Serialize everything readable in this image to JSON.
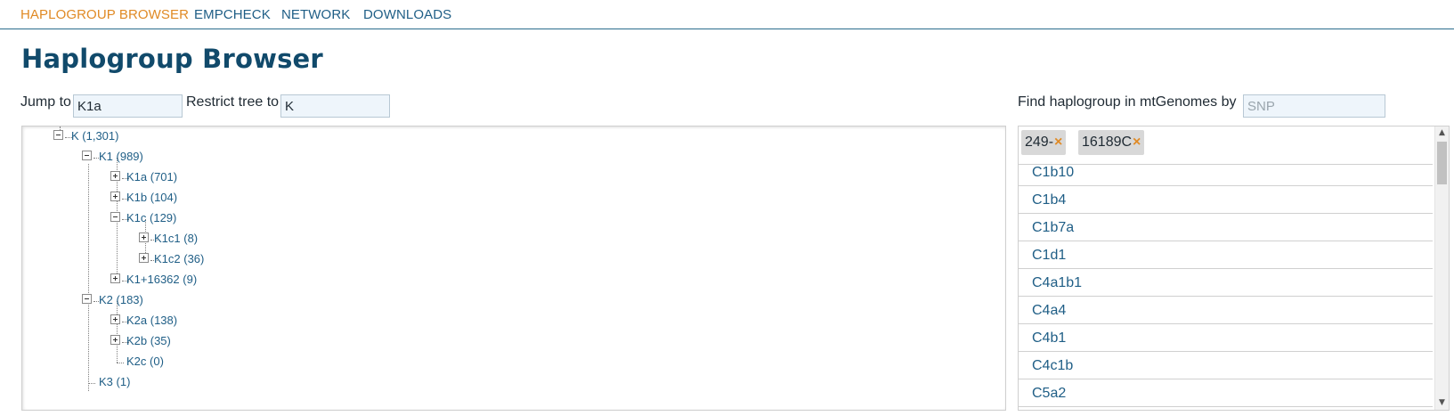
{
  "nav": {
    "items": [
      {
        "label": "HAPLOGROUP BROWSER",
        "active": true
      },
      {
        "label": "EMPCHECK",
        "active": false
      },
      {
        "label": "NETWORK",
        "active": false
      },
      {
        "label": "DOWNLOADS",
        "active": false
      }
    ]
  },
  "page_title": "Haplogroup Browser",
  "controls": {
    "jump_label": "Jump to",
    "jump_value": "K1a",
    "restrict_label": "Restrict tree to",
    "restrict_value": "K",
    "find_label": "Find haplogroup in mtGenomes by",
    "find_placeholder": "SNP"
  },
  "tree": {
    "nodes": [
      {
        "label": "K (1,301)",
        "toggle": "minus"
      },
      {
        "label": "K1 (989)",
        "toggle": "minus"
      },
      {
        "label": "K1a (701)",
        "toggle": "plus"
      },
      {
        "label": "K1b (104)",
        "toggle": "plus"
      },
      {
        "label": "K1c (129)",
        "toggle": "minus"
      },
      {
        "label": "K1c1 (8)",
        "toggle": "plus"
      },
      {
        "label": "K1c2 (36)",
        "toggle": "plus"
      },
      {
        "label": "K1+16362 (9)",
        "toggle": "plus"
      },
      {
        "label": "K2 (183)",
        "toggle": "minus"
      },
      {
        "label": "K2a (138)",
        "toggle": "plus"
      },
      {
        "label": "K2b (35)",
        "toggle": "plus"
      },
      {
        "label": "K2c (0)",
        "toggle": "none"
      },
      {
        "label": "K3 (1)",
        "toggle": "none"
      }
    ]
  },
  "snp_search": {
    "tags": [
      {
        "label": "249-",
        "remove": "×"
      },
      {
        "label": "16189C",
        "remove": "×"
      }
    ],
    "results": [
      "C1b10",
      "C1b4",
      "C1b7a",
      "C1d1",
      "C4a1b1",
      "C4a4",
      "C4b1",
      "C4c1b",
      "C5a2"
    ]
  },
  "colors": {
    "accent": "#e08a25",
    "link": "#1f5e86",
    "title": "#114a6b",
    "input_bg": "#eef5fb"
  }
}
